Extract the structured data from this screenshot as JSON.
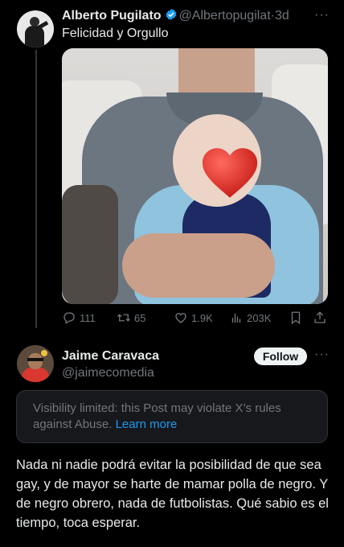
{
  "post1": {
    "author_name": "Alberto Pugilato",
    "handle": "@Albertopugilat",
    "separator": "·",
    "time": "3d",
    "text": "Felicidad y Orgullo",
    "more": "···",
    "stats": {
      "replies": "111",
      "reposts": "65",
      "likes": "1.9K",
      "views": "203K"
    }
  },
  "post2": {
    "author_name": "Jaime Caravaca",
    "handle": "@jaimecomedia",
    "follow_label": "Follow",
    "more": "···",
    "notice": {
      "text": "Visibility limited: this Post may violate X’s rules against Abuse.",
      "link": "Learn more"
    },
    "text": "Nada ni nadie podrá evitar la posibilidad de que sea gay, y de mayor se harte de mamar polla de negro. Y de negro obrero, nada de futbolistas. Qué sabio es el tiempo, toca esperar."
  },
  "colors": {
    "background": "#000000",
    "text": "#e7e9ea",
    "secondary": "#71767b",
    "accent": "#1d9bf0",
    "heart_emoji": "#e0332f"
  },
  "icons": [
    "verified-badge-icon",
    "reply-icon",
    "repost-icon",
    "like-icon",
    "views-icon",
    "bookmark-icon",
    "share-icon",
    "more-icon"
  ]
}
